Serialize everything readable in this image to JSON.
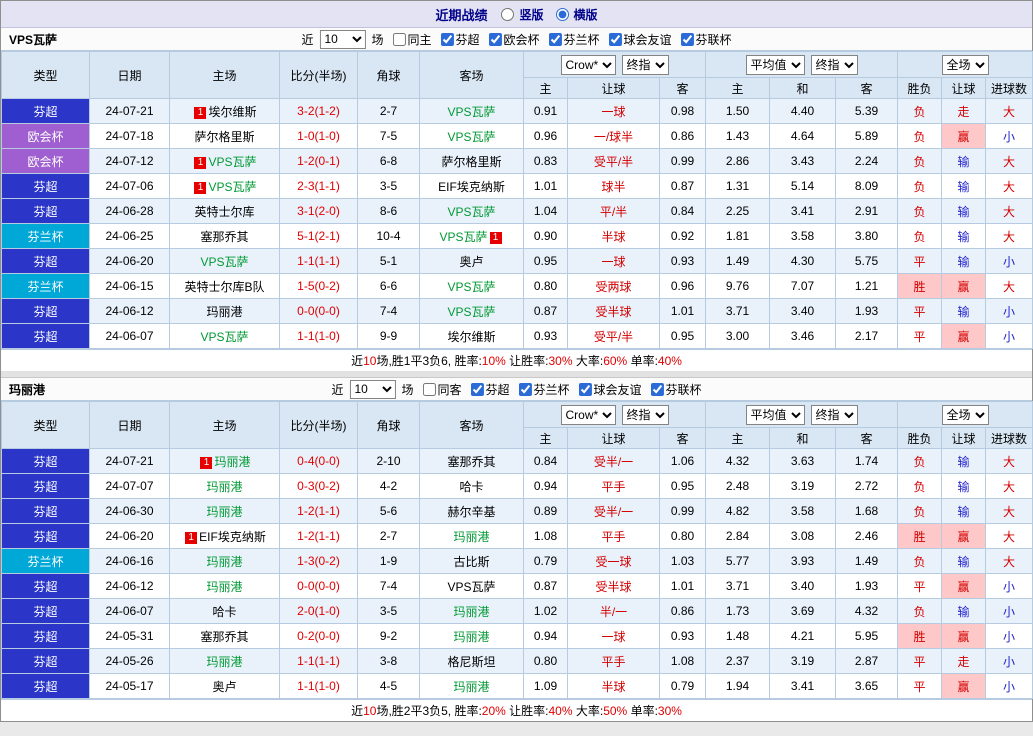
{
  "page": {
    "title": "近期战绩",
    "view_options": [
      {
        "label": "竖版",
        "selected": false
      },
      {
        "label": "横版",
        "selected": true
      }
    ]
  },
  "table_header": {
    "columns": [
      "类型",
      "日期",
      "主场",
      "比分(半场)",
      "角球",
      "客场"
    ],
    "odds_selects": [
      "Crow*",
      "终指"
    ],
    "avg_selects": [
      "平均值",
      "终指"
    ],
    "scope_select": "全场",
    "sub_columns": [
      "主",
      "让球",
      "客",
      "主",
      "和",
      "客",
      "胜负",
      "让球",
      "进球数"
    ],
    "recent_prefix": "近",
    "recent_suffix": "场"
  },
  "league_colors": {
    "芬超": "#2b35c8",
    "欧会杯": "#a05fd0",
    "芬兰杯": "#00a8d8"
  },
  "sections": [
    {
      "team": "VPS瓦萨",
      "recent_count": "10",
      "same_venue": {
        "label": "同主",
        "checked": false
      },
      "competitions": [
        {
          "label": "芬超",
          "checked": true
        },
        {
          "label": "欧会杯",
          "checked": true
        },
        {
          "label": "芬兰杯",
          "checked": true
        },
        {
          "label": "球会友谊",
          "checked": true
        },
        {
          "label": "芬联杯",
          "checked": true
        }
      ],
      "rows": [
        {
          "league": "芬超",
          "date": "24-07-21",
          "home": "埃尔维斯",
          "home_badge_before": "1",
          "home_green": false,
          "score": "3-2(1-2)",
          "corner": "2-7",
          "away": "VPS瓦萨",
          "away_green": true,
          "odds_home": "0.91",
          "handicap": "一球",
          "odds_away": "0.98",
          "avg_home": "1.50",
          "avg_draw": "4.40",
          "avg_away": "5.39",
          "result": "负",
          "result_style": "red",
          "cover": "走",
          "cover_style": "red",
          "goals": "大",
          "goals_style": "red"
        },
        {
          "league": "欧会杯",
          "date": "24-07-18",
          "home": "萨尔格里斯",
          "home_green": false,
          "score": "1-0(1-0)",
          "corner": "7-5",
          "away": "VPS瓦萨",
          "away_green": true,
          "odds_home": "0.96",
          "handicap": "一/球半",
          "odds_away": "0.86",
          "avg_home": "1.43",
          "avg_draw": "4.64",
          "avg_away": "5.89",
          "result": "负",
          "result_style": "red",
          "cover": "赢",
          "cover_style": "red-bg",
          "goals": "小",
          "goals_style": "blue"
        },
        {
          "league": "欧会杯",
          "date": "24-07-12",
          "home": "VPS瓦萨",
          "home_badge_before": "1",
          "home_green": true,
          "score": "1-2(0-1)",
          "corner": "6-8",
          "away": "萨尔格里斯",
          "away_green": false,
          "odds_home": "0.83",
          "handicap": "受平/半",
          "odds_away": "0.99",
          "avg_home": "2.86",
          "avg_draw": "3.43",
          "avg_away": "2.24",
          "result": "负",
          "result_style": "red",
          "cover": "输",
          "cover_style": "blue",
          "goals": "大",
          "goals_style": "red"
        },
        {
          "league": "芬超",
          "date": "24-07-06",
          "home": "VPS瓦萨",
          "home_badge_before": "1",
          "home_green": true,
          "score": "2-3(1-1)",
          "corner": "3-5",
          "away": "EIF埃克纳斯",
          "away_green": false,
          "odds_home": "1.01",
          "handicap": "球半",
          "odds_away": "0.87",
          "avg_home": "1.31",
          "avg_draw": "5.14",
          "avg_away": "8.09",
          "result": "负",
          "result_style": "red",
          "cover": "输",
          "cover_style": "blue",
          "goals": "大",
          "goals_style": "red"
        },
        {
          "league": "芬超",
          "date": "24-06-28",
          "home": "英特士尔库",
          "home_green": false,
          "score": "3-1(2-0)",
          "corner": "8-6",
          "away": "VPS瓦萨",
          "away_green": true,
          "odds_home": "1.04",
          "handicap": "平/半",
          "odds_away": "0.84",
          "avg_home": "2.25",
          "avg_draw": "3.41",
          "avg_away": "2.91",
          "result": "负",
          "result_style": "red",
          "cover": "输",
          "cover_style": "blue",
          "goals": "大",
          "goals_style": "red"
        },
        {
          "league": "芬兰杯",
          "date": "24-06-25",
          "home": "塞那乔其",
          "home_green": false,
          "score": "5-1(2-1)",
          "corner": "10-4",
          "away": "VPS瓦萨",
          "away_badge_after": "1",
          "away_green": true,
          "odds_home": "0.90",
          "handicap": "半球",
          "odds_away": "0.92",
          "avg_home": "1.81",
          "avg_draw": "3.58",
          "avg_away": "3.80",
          "result": "负",
          "result_style": "red",
          "cover": "输",
          "cover_style": "blue",
          "goals": "大",
          "goals_style": "red"
        },
        {
          "league": "芬超",
          "date": "24-06-20",
          "home": "VPS瓦萨",
          "home_green": true,
          "score": "1-1(1-1)",
          "corner": "5-1",
          "away": "奥卢",
          "away_green": false,
          "odds_home": "0.95",
          "handicap": "一球",
          "odds_away": "0.93",
          "avg_home": "1.49",
          "avg_draw": "4.30",
          "avg_away": "5.75",
          "result": "平",
          "result_style": "red",
          "cover": "输",
          "cover_style": "blue",
          "goals": "小",
          "goals_style": "blue"
        },
        {
          "league": "芬兰杯",
          "date": "24-06-15",
          "home": "英特士尔库B队",
          "home_green": false,
          "score": "1-5(0-2)",
          "corner": "6-6",
          "away": "VPS瓦萨",
          "away_green": true,
          "odds_home": "0.80",
          "handicap": "受两球",
          "odds_away": "0.96",
          "avg_home": "9.76",
          "avg_draw": "7.07",
          "avg_away": "1.21",
          "result": "胜",
          "result_style": "red-bg",
          "cover": "赢",
          "cover_style": "red-bg",
          "goals": "大",
          "goals_style": "red"
        },
        {
          "league": "芬超",
          "date": "24-06-12",
          "home": "玛丽港",
          "home_green": false,
          "score": "0-0(0-0)",
          "corner": "7-4",
          "away": "VPS瓦萨",
          "away_green": true,
          "odds_home": "0.87",
          "handicap": "受半球",
          "odds_away": "1.01",
          "avg_home": "3.71",
          "avg_draw": "3.40",
          "avg_away": "1.93",
          "result": "平",
          "result_style": "red",
          "cover": "输",
          "cover_style": "blue",
          "goals": "小",
          "goals_style": "blue"
        },
        {
          "league": "芬超",
          "date": "24-06-07",
          "home": "VPS瓦萨",
          "home_green": true,
          "score": "1-1(1-0)",
          "corner": "9-9",
          "away": "埃尔维斯",
          "away_green": false,
          "odds_home": "0.93",
          "handicap": "受平/半",
          "odds_away": "0.95",
          "avg_home": "3.00",
          "avg_draw": "3.46",
          "avg_away": "2.17",
          "result": "平",
          "result_style": "red",
          "cover": "赢",
          "cover_style": "red-bg",
          "goals": "小",
          "goals_style": "blue"
        }
      ],
      "summary": [
        {
          "text": "近"
        },
        {
          "text": "10",
          "red": true
        },
        {
          "text": "场,胜1平3负6, 胜率:"
        },
        {
          "text": "10%",
          "red": true
        },
        {
          "text": " 让胜率:"
        },
        {
          "text": "30%",
          "red": true
        },
        {
          "text": " 大率:"
        },
        {
          "text": "60%",
          "red": true
        },
        {
          "text": " 单率:"
        },
        {
          "text": "40%",
          "red": true
        }
      ]
    },
    {
      "team": "玛丽港",
      "recent_count": "10",
      "same_venue": {
        "label": "同客",
        "checked": false
      },
      "competitions": [
        {
          "label": "芬超",
          "checked": true
        },
        {
          "label": "芬兰杯",
          "checked": true
        },
        {
          "label": "球会友谊",
          "checked": true
        },
        {
          "label": "芬联杯",
          "checked": true
        }
      ],
      "rows": [
        {
          "league": "芬超",
          "date": "24-07-21",
          "home": "玛丽港",
          "home_badge_before": "1",
          "home_green": true,
          "score": "0-4(0-0)",
          "corner": "2-10",
          "away": "塞那乔其",
          "away_green": false,
          "odds_home": "0.84",
          "handicap": "受半/一",
          "odds_away": "1.06",
          "avg_home": "4.32",
          "avg_draw": "3.63",
          "avg_away": "1.74",
          "result": "负",
          "result_style": "red",
          "cover": "输",
          "cover_style": "blue",
          "goals": "大",
          "goals_style": "red"
        },
        {
          "league": "芬超",
          "date": "24-07-07",
          "home": "玛丽港",
          "home_green": true,
          "score": "0-3(0-2)",
          "corner": "4-2",
          "away": "哈卡",
          "away_green": false,
          "odds_home": "0.94",
          "handicap": "平手",
          "odds_away": "0.95",
          "avg_home": "2.48",
          "avg_draw": "3.19",
          "avg_away": "2.72",
          "result": "负",
          "result_style": "red",
          "cover": "输",
          "cover_style": "blue",
          "goals": "大",
          "goals_style": "red"
        },
        {
          "league": "芬超",
          "date": "24-06-30",
          "home": "玛丽港",
          "home_green": true,
          "score": "1-2(1-1)",
          "corner": "5-6",
          "away": "赫尔辛基",
          "away_green": false,
          "odds_home": "0.89",
          "handicap": "受半/一",
          "odds_away": "0.99",
          "avg_home": "4.82",
          "avg_draw": "3.58",
          "avg_away": "1.68",
          "result": "负",
          "result_style": "red",
          "cover": "输",
          "cover_style": "blue",
          "goals": "大",
          "goals_style": "red"
        },
        {
          "league": "芬超",
          "date": "24-06-20",
          "home": "EIF埃克纳斯",
          "home_badge_before": "1",
          "home_green": false,
          "score": "1-2(1-1)",
          "corner": "2-7",
          "away": "玛丽港",
          "away_green": true,
          "odds_home": "1.08",
          "handicap": "平手",
          "odds_away": "0.80",
          "avg_home": "2.84",
          "avg_draw": "3.08",
          "avg_away": "2.46",
          "result": "胜",
          "result_style": "red-bg",
          "cover": "赢",
          "cover_style": "red-bg",
          "goals": "大",
          "goals_style": "red"
        },
        {
          "league": "芬兰杯",
          "date": "24-06-16",
          "home": "玛丽港",
          "home_green": true,
          "score": "1-3(0-2)",
          "corner": "1-9",
          "away": "古比斯",
          "away_green": false,
          "odds_home": "0.79",
          "handicap": "受一球",
          "odds_away": "1.03",
          "avg_home": "5.77",
          "avg_draw": "3.93",
          "avg_away": "1.49",
          "result": "负",
          "result_style": "red",
          "cover": "输",
          "cover_style": "blue",
          "goals": "大",
          "goals_style": "red"
        },
        {
          "league": "芬超",
          "date": "24-06-12",
          "home": "玛丽港",
          "home_green": true,
          "score": "0-0(0-0)",
          "corner": "7-4",
          "away": "VPS瓦萨",
          "away_green": false,
          "odds_home": "0.87",
          "handicap": "受半球",
          "odds_away": "1.01",
          "avg_home": "3.71",
          "avg_draw": "3.40",
          "avg_away": "1.93",
          "result": "平",
          "result_style": "red",
          "cover": "赢",
          "cover_style": "red-bg",
          "goals": "小",
          "goals_style": "blue"
        },
        {
          "league": "芬超",
          "date": "24-06-07",
          "home": "哈卡",
          "home_green": false,
          "score": "2-0(1-0)",
          "corner": "3-5",
          "away": "玛丽港",
          "away_green": true,
          "odds_home": "1.02",
          "handicap": "半/一",
          "odds_away": "0.86",
          "avg_home": "1.73",
          "avg_draw": "3.69",
          "avg_away": "4.32",
          "result": "负",
          "result_style": "red",
          "cover": "输",
          "cover_style": "blue",
          "goals": "小",
          "goals_style": "blue"
        },
        {
          "league": "芬超",
          "date": "24-05-31",
          "home": "塞那乔其",
          "home_green": false,
          "score": "0-2(0-0)",
          "corner": "9-2",
          "away": "玛丽港",
          "away_green": true,
          "odds_home": "0.94",
          "handicap": "一球",
          "odds_away": "0.93",
          "avg_home": "1.48",
          "avg_draw": "4.21",
          "avg_away": "5.95",
          "result": "胜",
          "result_style": "red-bg",
          "cover": "赢",
          "cover_style": "red-bg",
          "goals": "小",
          "goals_style": "blue"
        },
        {
          "league": "芬超",
          "date": "24-05-26",
          "home": "玛丽港",
          "home_green": true,
          "score": "1-1(1-1)",
          "corner": "3-8",
          "away": "格尼斯坦",
          "away_green": false,
          "odds_home": "0.80",
          "handicap": "平手",
          "odds_away": "1.08",
          "avg_home": "2.37",
          "avg_draw": "3.19",
          "avg_away": "2.87",
          "result": "平",
          "result_style": "red",
          "cover": "走",
          "cover_style": "red",
          "goals": "小",
          "goals_style": "blue"
        },
        {
          "league": "芬超",
          "date": "24-05-17",
          "home": "奥卢",
          "home_green": false,
          "score": "1-1(1-0)",
          "corner": "4-5",
          "away": "玛丽港",
          "away_green": true,
          "odds_home": "1.09",
          "handicap": "半球",
          "odds_away": "0.79",
          "avg_home": "1.94",
          "avg_draw": "3.41",
          "avg_away": "3.65",
          "result": "平",
          "result_style": "red",
          "cover": "赢",
          "cover_style": "red-bg",
          "goals": "小",
          "goals_style": "blue"
        }
      ],
      "summary": [
        {
          "text": "近"
        },
        {
          "text": "10",
          "red": true
        },
        {
          "text": "场,胜2平3负5, 胜率:"
        },
        {
          "text": "20%",
          "red": true
        },
        {
          "text": " 让胜率:"
        },
        {
          "text": "40%",
          "red": true
        },
        {
          "text": " 大率:"
        },
        {
          "text": "50%",
          "red": true
        },
        {
          "text": " 单率:"
        },
        {
          "text": "30%",
          "red": true
        }
      ]
    }
  ]
}
